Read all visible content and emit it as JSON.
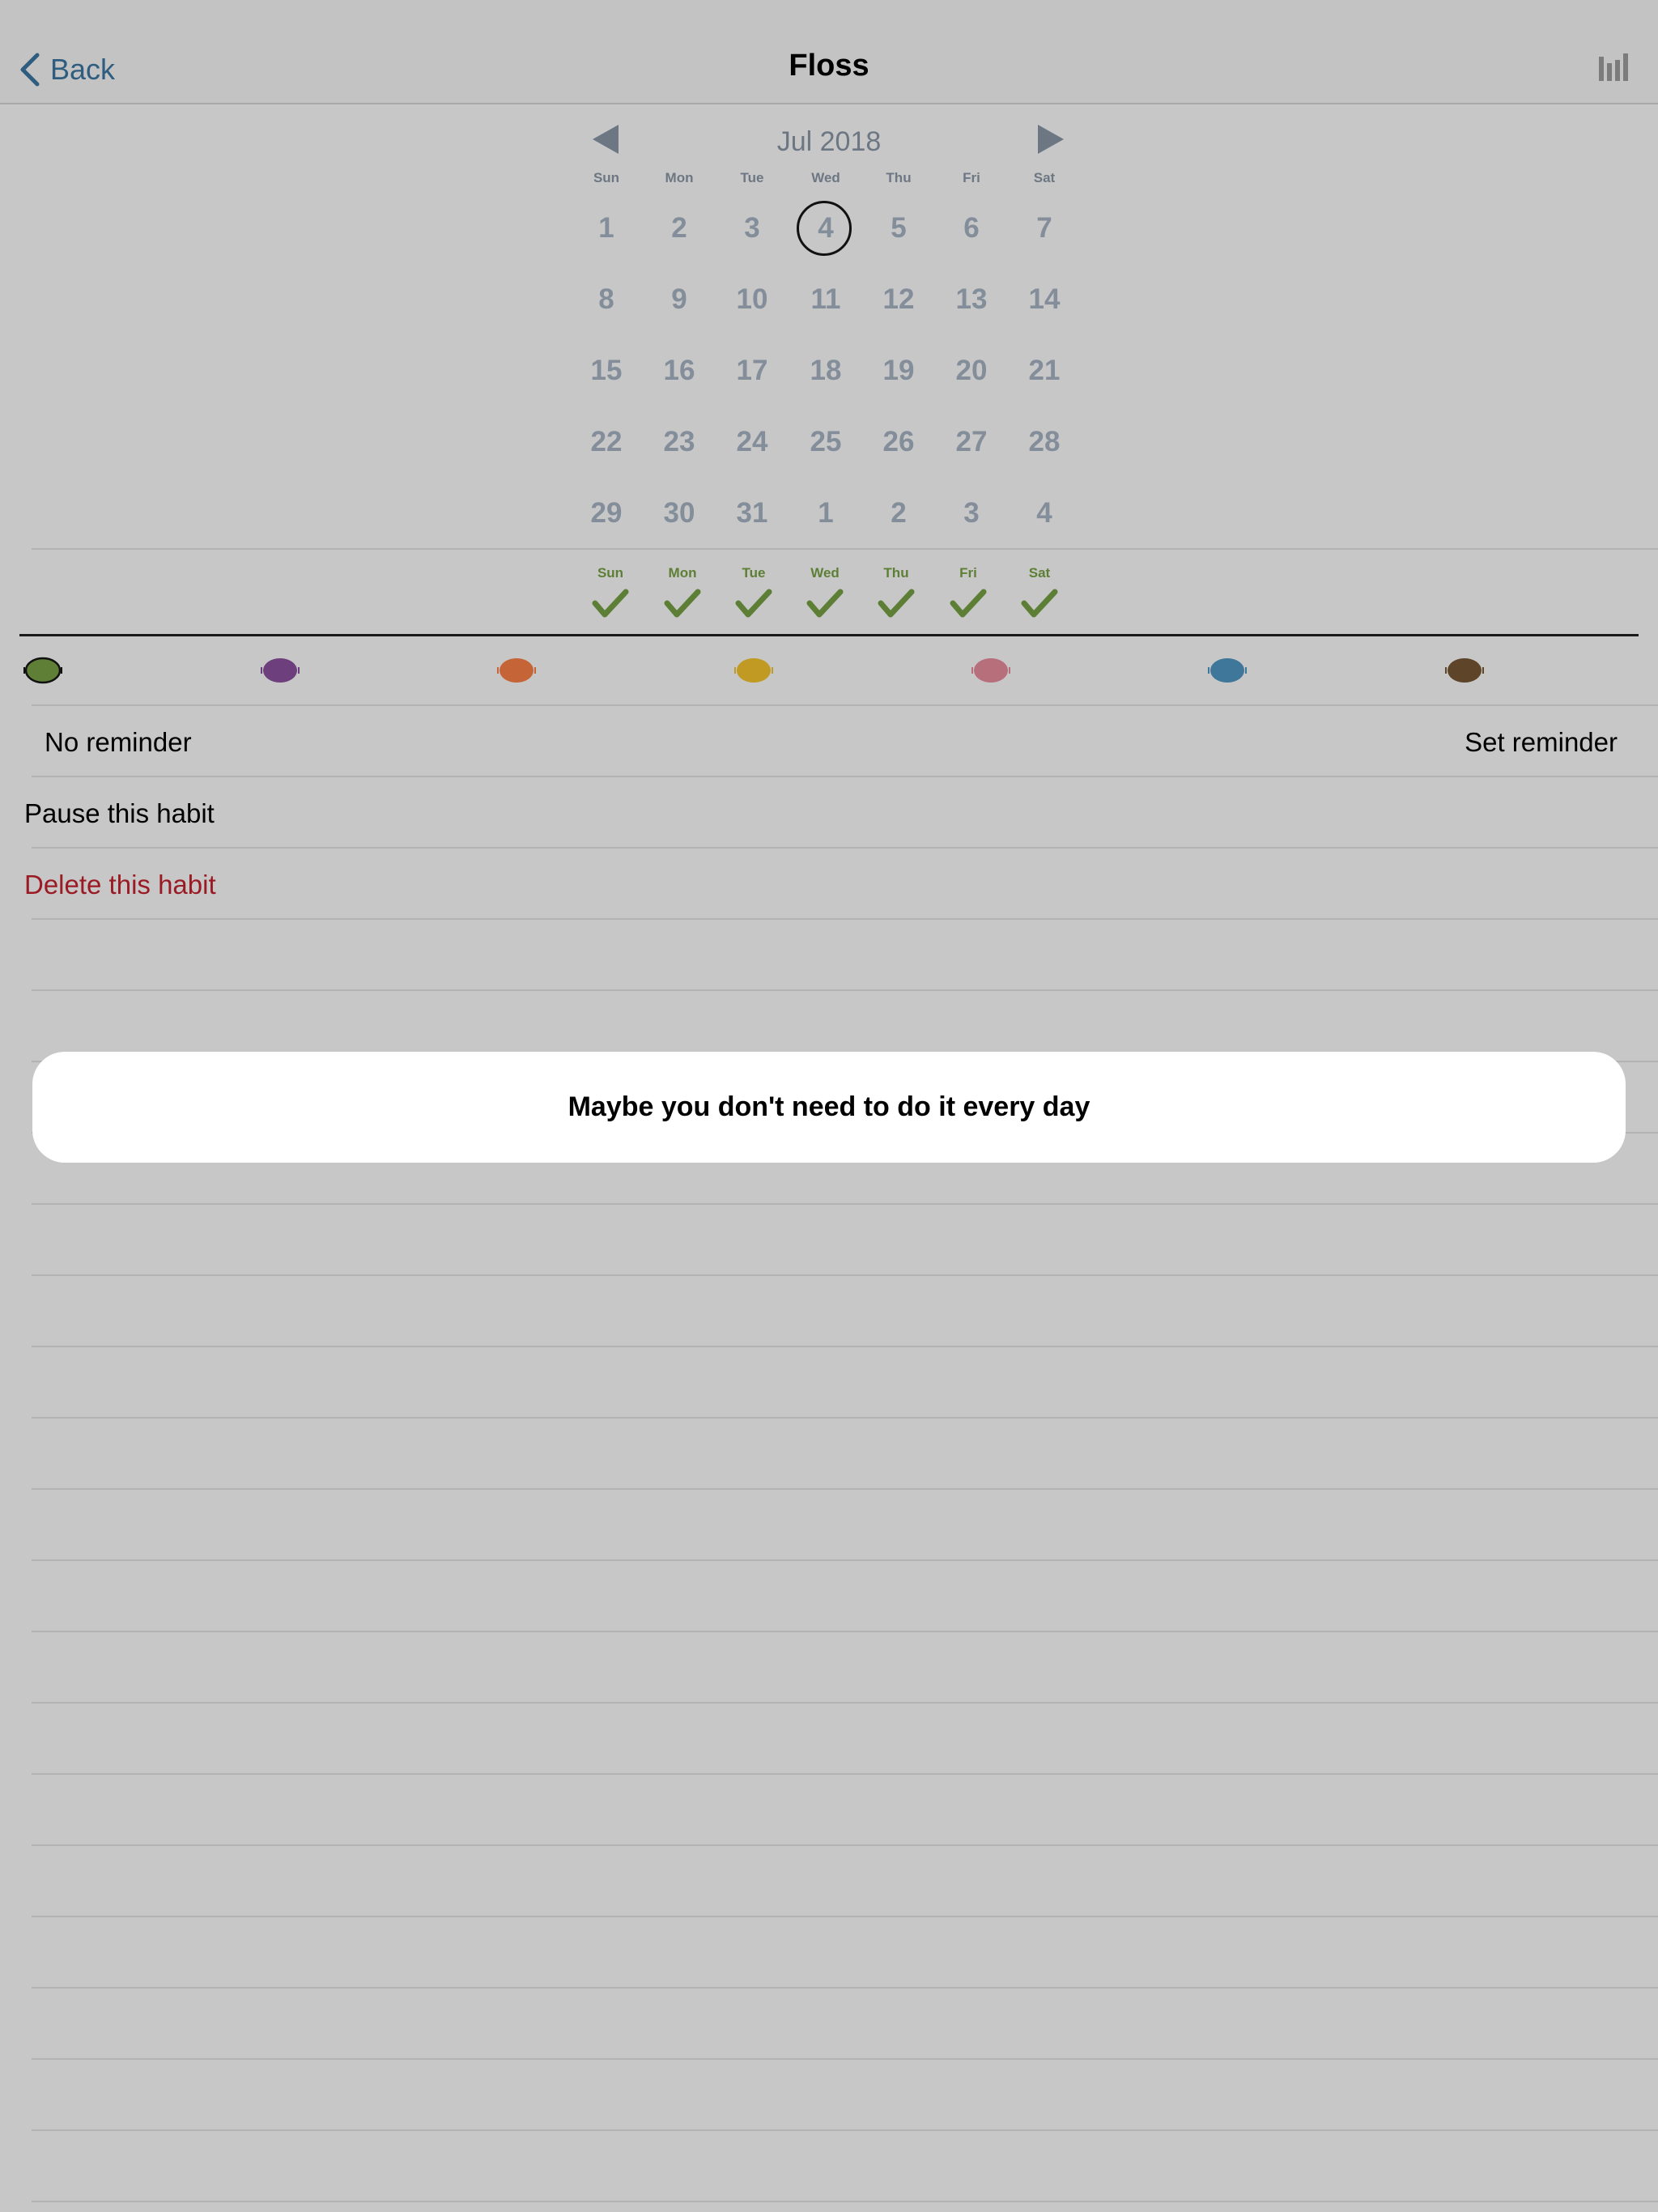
{
  "nav": {
    "back_label": "Back",
    "title": "Floss"
  },
  "calendar": {
    "month_label": "Jul 2018",
    "weekdays": [
      "Sun",
      "Mon",
      "Tue",
      "Wed",
      "Thu",
      "Fri",
      "Sat"
    ],
    "weeks": [
      [
        "1",
        "2",
        "3",
        "4",
        "5",
        "6",
        "7"
      ],
      [
        "8",
        "9",
        "10",
        "11",
        "12",
        "13",
        "14"
      ],
      [
        "15",
        "16",
        "17",
        "18",
        "19",
        "20",
        "21"
      ],
      [
        "22",
        "23",
        "24",
        "25",
        "26",
        "27",
        "28"
      ],
      [
        "29",
        "30",
        "31",
        "1",
        "2",
        "3",
        "4"
      ]
    ],
    "selected_day": "4"
  },
  "schedule": {
    "days": [
      "Sun",
      "Mon",
      "Tue",
      "Wed",
      "Thu",
      "Fri",
      "Sat"
    ],
    "accent": "#5d7f35"
  },
  "colors": {
    "options": [
      "#5f7f37",
      "#6e3f7d",
      "#c56436",
      "#c09a23",
      "#b76f7b",
      "#3f779b",
      "#5e4428"
    ],
    "selected_index": 0
  },
  "reminder": {
    "status": "No reminder",
    "action": "Set reminder"
  },
  "actions": {
    "pause": "Pause this habit",
    "delete": "Delete this habit",
    "delete_color": "#9b1b25"
  },
  "toast": {
    "message": "Maybe you don't need to do it every day"
  }
}
